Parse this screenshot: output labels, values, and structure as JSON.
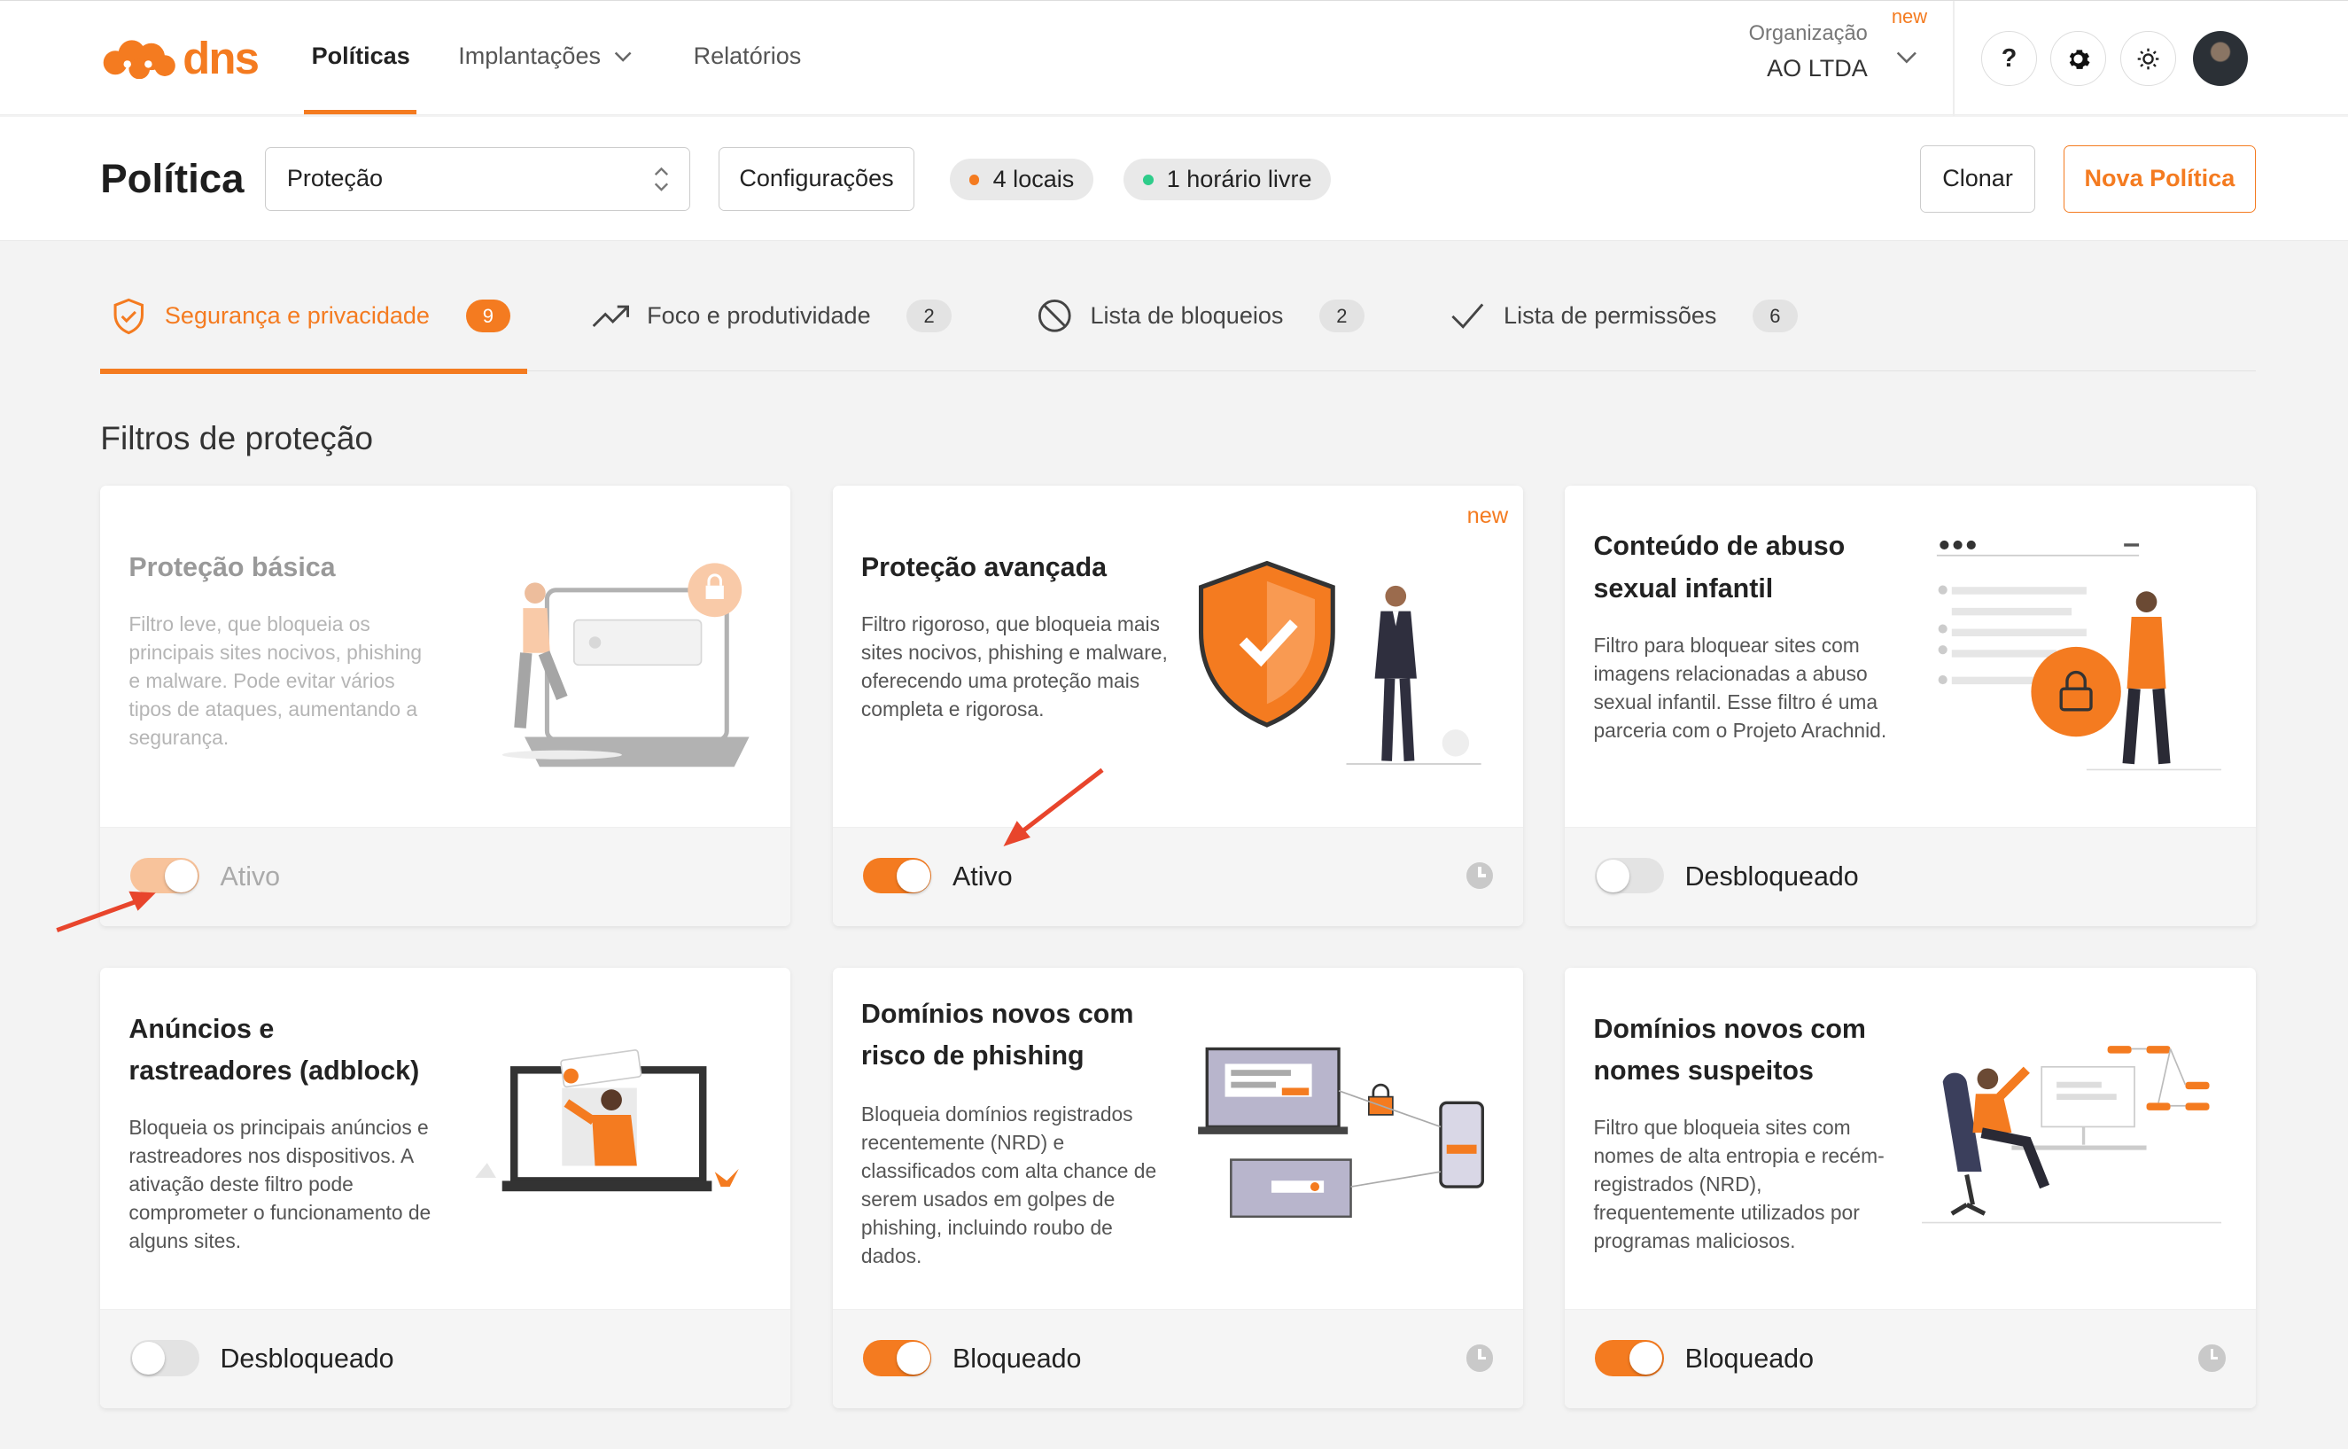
{
  "brand": {
    "name": "dns",
    "color": "#f47b20"
  },
  "nav": {
    "politicas": "Políticas",
    "implantacoes": "Implantações",
    "relatorios": "Relatórios"
  },
  "org": {
    "label": "Organização",
    "value": "AO LTDA",
    "new_badge": "new"
  },
  "header_buttons": {
    "help": "?",
    "settings_icon": "gear-icon",
    "theme_icon": "sun-icon"
  },
  "policy": {
    "title": "Política",
    "select_value": "Proteção",
    "config_button": "Configurações",
    "locations_pill": "4 locais",
    "freetime_pill": "1 horário livre",
    "clone_button": "Clonar",
    "new_button": "Nova Política"
  },
  "tabs": [
    {
      "label": "Segurança e privacidade",
      "count": "9",
      "icon": "shield-check-icon",
      "active": true
    },
    {
      "label": "Foco e produtividade",
      "count": "2",
      "icon": "trending-up-icon"
    },
    {
      "label": "Lista de bloqueios",
      "count": "2",
      "icon": "block-icon"
    },
    {
      "label": "Lista de permissões",
      "count": "6",
      "icon": "check-icon"
    }
  ],
  "section_title": "Filtros de proteção",
  "cards": [
    {
      "title": "Proteção básica",
      "desc": "Filtro leve, que bloqueia os principais sites nocivos, phishing e malware. Pode evitar vários tipos de ataques, aumentando a segurança.",
      "status": "Ativo",
      "toggle_on": true,
      "faded": true
    },
    {
      "title": "Proteção avançada",
      "desc": "Filtro rigoroso, que bloqueia mais sites nocivos, phishing e malware, oferecendo uma proteção mais completa e rigorosa.",
      "status": "Ativo",
      "toggle_on": true,
      "new_badge": "new"
    },
    {
      "title": "Conteúdo de abuso sexual infantil",
      "desc": "Filtro para bloquear sites com imagens relacionadas a abuso sexual infantil. Esse filtro é uma parceria com o Projeto Arachnid.",
      "status": "Desbloqueado",
      "toggle_on": false
    },
    {
      "title": "Anúncios e rastreadores (adblock)",
      "desc": "Bloqueia os principais anúncios e rastreadores nos dispositivos. A ativação deste filtro pode comprometer o funcionamento de alguns sites.",
      "status": "Desbloqueado",
      "toggle_on": false
    },
    {
      "title": "Domínios novos com risco de phishing",
      "desc": "Bloqueia domínios registrados recentemente (NRD) e classificados com alta chance de serem usados em golpes de phishing, incluindo roubo de dados.",
      "status": "Bloqueado",
      "toggle_on": true
    },
    {
      "title": "Domínios novos com nomes suspeitos",
      "desc": "Filtro que bloqueia sites com nomes de alta entropia e recém-registrados (NRD), frequentemente utilizados por programas maliciosos.",
      "status": "Bloqueado",
      "toggle_on": true
    }
  ]
}
